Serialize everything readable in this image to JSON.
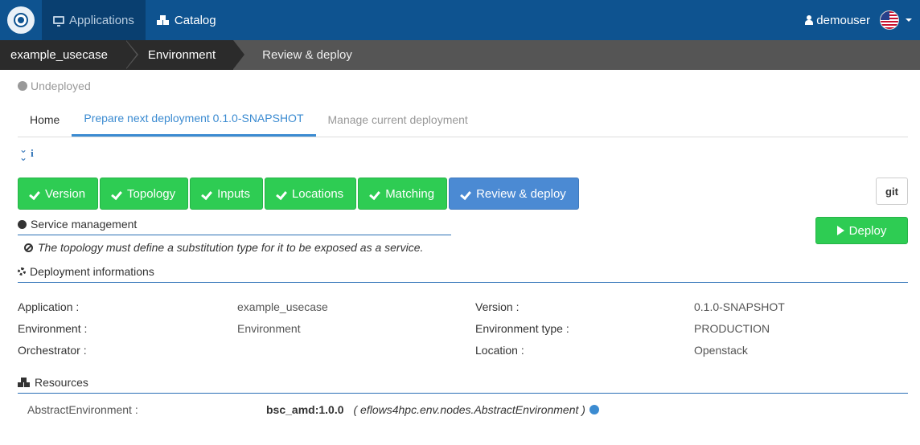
{
  "topnav": {
    "applications_label": "Applications",
    "catalog_label": "Catalog",
    "username": "demouser"
  },
  "breadcrumb": {
    "items": [
      "example_usecase",
      "Environment",
      "Review & deploy"
    ]
  },
  "status": {
    "label": "Undeployed"
  },
  "tabs": [
    {
      "label": "Home"
    },
    {
      "label": "Prepare next deployment 0.1.0-SNAPSHOT"
    },
    {
      "label": "Manage current deployment"
    }
  ],
  "steps": [
    {
      "label": "Version"
    },
    {
      "label": "Topology"
    },
    {
      "label": "Inputs"
    },
    {
      "label": "Locations"
    },
    {
      "label": "Matching"
    },
    {
      "label": "Review & deploy"
    }
  ],
  "git_label": "git",
  "deploy_label": "Deploy",
  "service_management": {
    "title": "Service management",
    "message": "The topology must define a substitution type for it to be exposed as a service."
  },
  "deployment_info": {
    "title": "Deployment informations",
    "rows": [
      {
        "label1": "Application :",
        "value1": "example_usecase",
        "label2": "Version :",
        "value2": "0.1.0-SNAPSHOT"
      },
      {
        "label1": "Environment :",
        "value1": "Environment",
        "label2": "Environment type :",
        "value2": "PRODUCTION"
      },
      {
        "label1": "Orchestrator :",
        "value1": "",
        "label2": "Location :",
        "value2": "Openstack"
      }
    ]
  },
  "resources": {
    "title": "Resources",
    "items": [
      {
        "name": "AbstractEnvironment :",
        "type": "bsc_amd:1.0.0",
        "full_type": "( eflows4hpc.env.nodes.AbstractEnvironment )"
      }
    ]
  },
  "colors": {
    "navbar": "#0e5390",
    "step_done": "#2ecc53",
    "step_active": "#4b8ad3",
    "accent": "#3b8bd1"
  }
}
